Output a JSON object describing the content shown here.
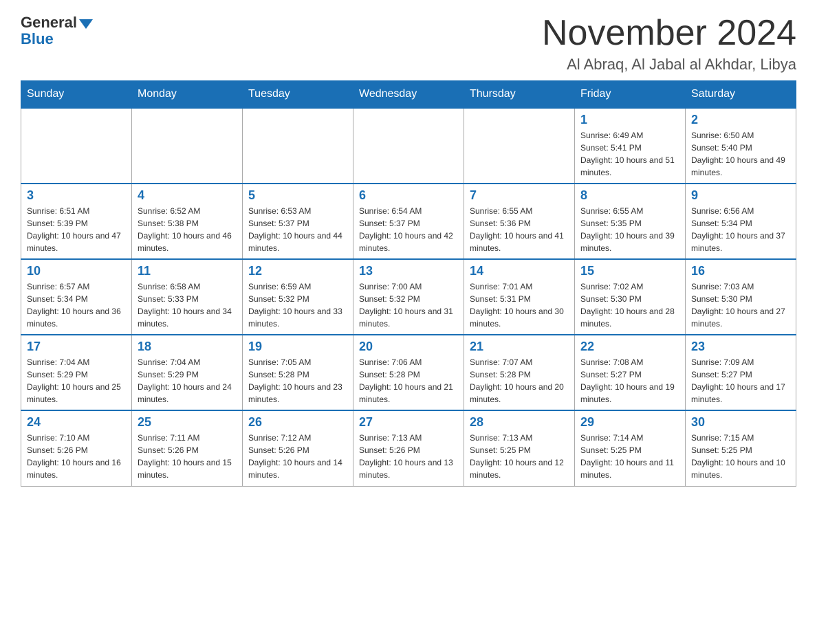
{
  "header": {
    "logo_general": "General",
    "logo_blue": "Blue",
    "month_title": "November 2024",
    "location": "Al Abraq, Al Jabal al Akhdar, Libya"
  },
  "weekdays": [
    "Sunday",
    "Monday",
    "Tuesday",
    "Wednesday",
    "Thursday",
    "Friday",
    "Saturday"
  ],
  "weeks": [
    [
      {
        "day": "",
        "sunrise": "",
        "sunset": "",
        "daylight": ""
      },
      {
        "day": "",
        "sunrise": "",
        "sunset": "",
        "daylight": ""
      },
      {
        "day": "",
        "sunrise": "",
        "sunset": "",
        "daylight": ""
      },
      {
        "day": "",
        "sunrise": "",
        "sunset": "",
        "daylight": ""
      },
      {
        "day": "",
        "sunrise": "",
        "sunset": "",
        "daylight": ""
      },
      {
        "day": "1",
        "sunrise": "Sunrise: 6:49 AM",
        "sunset": "Sunset: 5:41 PM",
        "daylight": "Daylight: 10 hours and 51 minutes."
      },
      {
        "day": "2",
        "sunrise": "Sunrise: 6:50 AM",
        "sunset": "Sunset: 5:40 PM",
        "daylight": "Daylight: 10 hours and 49 minutes."
      }
    ],
    [
      {
        "day": "3",
        "sunrise": "Sunrise: 6:51 AM",
        "sunset": "Sunset: 5:39 PM",
        "daylight": "Daylight: 10 hours and 47 minutes."
      },
      {
        "day": "4",
        "sunrise": "Sunrise: 6:52 AM",
        "sunset": "Sunset: 5:38 PM",
        "daylight": "Daylight: 10 hours and 46 minutes."
      },
      {
        "day": "5",
        "sunrise": "Sunrise: 6:53 AM",
        "sunset": "Sunset: 5:37 PM",
        "daylight": "Daylight: 10 hours and 44 minutes."
      },
      {
        "day": "6",
        "sunrise": "Sunrise: 6:54 AM",
        "sunset": "Sunset: 5:37 PM",
        "daylight": "Daylight: 10 hours and 42 minutes."
      },
      {
        "day": "7",
        "sunrise": "Sunrise: 6:55 AM",
        "sunset": "Sunset: 5:36 PM",
        "daylight": "Daylight: 10 hours and 41 minutes."
      },
      {
        "day": "8",
        "sunrise": "Sunrise: 6:55 AM",
        "sunset": "Sunset: 5:35 PM",
        "daylight": "Daylight: 10 hours and 39 minutes."
      },
      {
        "day": "9",
        "sunrise": "Sunrise: 6:56 AM",
        "sunset": "Sunset: 5:34 PM",
        "daylight": "Daylight: 10 hours and 37 minutes."
      }
    ],
    [
      {
        "day": "10",
        "sunrise": "Sunrise: 6:57 AM",
        "sunset": "Sunset: 5:34 PM",
        "daylight": "Daylight: 10 hours and 36 minutes."
      },
      {
        "day": "11",
        "sunrise": "Sunrise: 6:58 AM",
        "sunset": "Sunset: 5:33 PM",
        "daylight": "Daylight: 10 hours and 34 minutes."
      },
      {
        "day": "12",
        "sunrise": "Sunrise: 6:59 AM",
        "sunset": "Sunset: 5:32 PM",
        "daylight": "Daylight: 10 hours and 33 minutes."
      },
      {
        "day": "13",
        "sunrise": "Sunrise: 7:00 AM",
        "sunset": "Sunset: 5:32 PM",
        "daylight": "Daylight: 10 hours and 31 minutes."
      },
      {
        "day": "14",
        "sunrise": "Sunrise: 7:01 AM",
        "sunset": "Sunset: 5:31 PM",
        "daylight": "Daylight: 10 hours and 30 minutes."
      },
      {
        "day": "15",
        "sunrise": "Sunrise: 7:02 AM",
        "sunset": "Sunset: 5:30 PM",
        "daylight": "Daylight: 10 hours and 28 minutes."
      },
      {
        "day": "16",
        "sunrise": "Sunrise: 7:03 AM",
        "sunset": "Sunset: 5:30 PM",
        "daylight": "Daylight: 10 hours and 27 minutes."
      }
    ],
    [
      {
        "day": "17",
        "sunrise": "Sunrise: 7:04 AM",
        "sunset": "Sunset: 5:29 PM",
        "daylight": "Daylight: 10 hours and 25 minutes."
      },
      {
        "day": "18",
        "sunrise": "Sunrise: 7:04 AM",
        "sunset": "Sunset: 5:29 PM",
        "daylight": "Daylight: 10 hours and 24 minutes."
      },
      {
        "day": "19",
        "sunrise": "Sunrise: 7:05 AM",
        "sunset": "Sunset: 5:28 PM",
        "daylight": "Daylight: 10 hours and 23 minutes."
      },
      {
        "day": "20",
        "sunrise": "Sunrise: 7:06 AM",
        "sunset": "Sunset: 5:28 PM",
        "daylight": "Daylight: 10 hours and 21 minutes."
      },
      {
        "day": "21",
        "sunrise": "Sunrise: 7:07 AM",
        "sunset": "Sunset: 5:28 PM",
        "daylight": "Daylight: 10 hours and 20 minutes."
      },
      {
        "day": "22",
        "sunrise": "Sunrise: 7:08 AM",
        "sunset": "Sunset: 5:27 PM",
        "daylight": "Daylight: 10 hours and 19 minutes."
      },
      {
        "day": "23",
        "sunrise": "Sunrise: 7:09 AM",
        "sunset": "Sunset: 5:27 PM",
        "daylight": "Daylight: 10 hours and 17 minutes."
      }
    ],
    [
      {
        "day": "24",
        "sunrise": "Sunrise: 7:10 AM",
        "sunset": "Sunset: 5:26 PM",
        "daylight": "Daylight: 10 hours and 16 minutes."
      },
      {
        "day": "25",
        "sunrise": "Sunrise: 7:11 AM",
        "sunset": "Sunset: 5:26 PM",
        "daylight": "Daylight: 10 hours and 15 minutes."
      },
      {
        "day": "26",
        "sunrise": "Sunrise: 7:12 AM",
        "sunset": "Sunset: 5:26 PM",
        "daylight": "Daylight: 10 hours and 14 minutes."
      },
      {
        "day": "27",
        "sunrise": "Sunrise: 7:13 AM",
        "sunset": "Sunset: 5:26 PM",
        "daylight": "Daylight: 10 hours and 13 minutes."
      },
      {
        "day": "28",
        "sunrise": "Sunrise: 7:13 AM",
        "sunset": "Sunset: 5:25 PM",
        "daylight": "Daylight: 10 hours and 12 minutes."
      },
      {
        "day": "29",
        "sunrise": "Sunrise: 7:14 AM",
        "sunset": "Sunset: 5:25 PM",
        "daylight": "Daylight: 10 hours and 11 minutes."
      },
      {
        "day": "30",
        "sunrise": "Sunrise: 7:15 AM",
        "sunset": "Sunset: 5:25 PM",
        "daylight": "Daylight: 10 hours and 10 minutes."
      }
    ]
  ]
}
